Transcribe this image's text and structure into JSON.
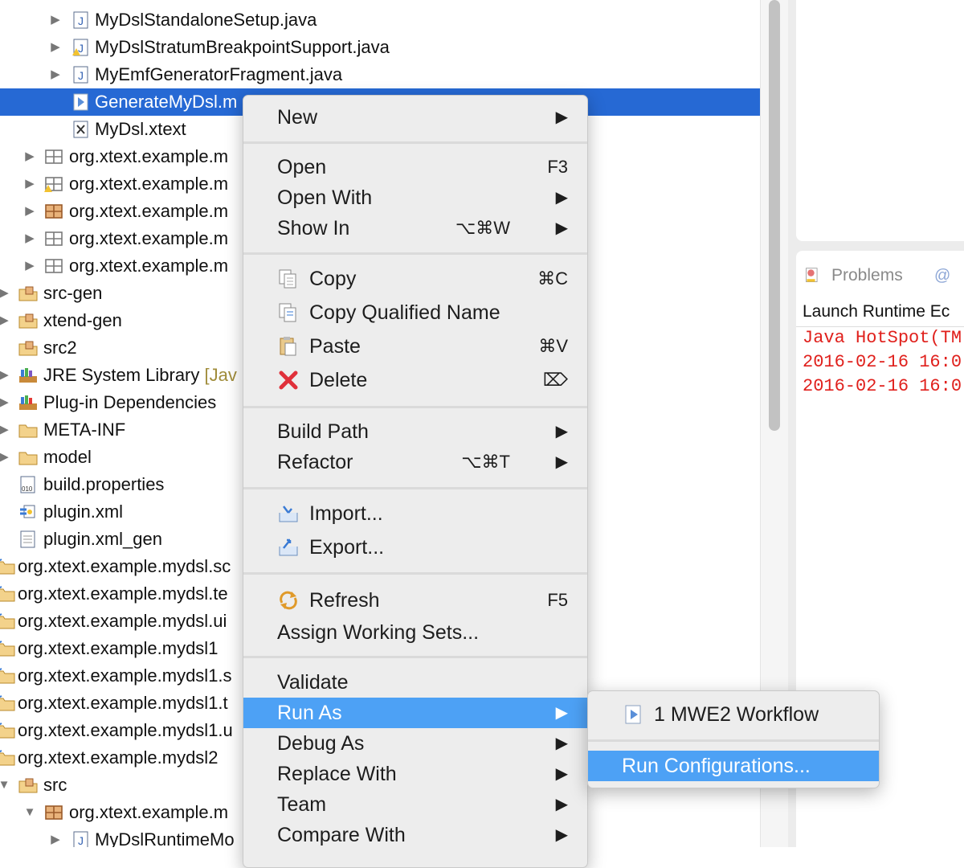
{
  "tree": {
    "rows": [
      {
        "label": "MyDslStandaloneSetup.java",
        "icon": "java-file-icon"
      },
      {
        "label": "MyDslStratumBreakpointSupport.java",
        "icon": "java-file-warning-icon"
      },
      {
        "label": "MyEmfGeneratorFragment.java",
        "icon": "java-file-icon"
      },
      {
        "label": "GenerateMyDsl.m",
        "icon": "mwe2-file-icon"
      },
      {
        "label": "MyDsl.xtext",
        "icon": "xtext-file-icon"
      },
      {
        "label": "org.xtext.example.m",
        "icon": "package-icon"
      },
      {
        "label": "org.xtext.example.m",
        "icon": "package-warning-icon"
      },
      {
        "label": "org.xtext.example.m",
        "icon": "package-icon"
      },
      {
        "label": "org.xtext.example.m",
        "icon": "package-icon"
      },
      {
        "label": "org.xtext.example.m",
        "icon": "package-icon"
      },
      {
        "label": "src-gen",
        "icon": "source-folder-icon"
      },
      {
        "label": "xtend-gen",
        "icon": "source-folder-icon"
      },
      {
        "label": "src2",
        "icon": "source-folder-icon"
      },
      {
        "label": "JRE System Library",
        "decoration": "[Jav",
        "icon": "library-icon"
      },
      {
        "label": "Plug-in Dependencies",
        "icon": "library-icon"
      },
      {
        "label": "META-INF",
        "icon": "folder-icon"
      },
      {
        "label": "model",
        "icon": "folder-icon"
      },
      {
        "label": "build.properties",
        "icon": "properties-file-icon"
      },
      {
        "label": "plugin.xml",
        "icon": "plugin-xml-icon"
      },
      {
        "label": "plugin.xml_gen",
        "icon": "text-file-icon"
      },
      {
        "label": "org.xtext.example.mydsl.sc",
        "icon": "project-icon"
      },
      {
        "label": "org.xtext.example.mydsl.te",
        "icon": "project-icon"
      },
      {
        "label": "org.xtext.example.mydsl.ui",
        "icon": "project-icon"
      },
      {
        "label": "org.xtext.example.mydsl1",
        "icon": "project-icon"
      },
      {
        "label": "org.xtext.example.mydsl1.s",
        "icon": "project-icon"
      },
      {
        "label": "org.xtext.example.mydsl1.t",
        "icon": "project-icon"
      },
      {
        "label": "org.xtext.example.mydsl1.u",
        "icon": "project-icon"
      },
      {
        "label": "org.xtext.example.mydsl2",
        "icon": "project-icon"
      },
      {
        "label": "src",
        "icon": "source-folder-icon"
      },
      {
        "label": "org.xtext.example.m",
        "icon": "package-icon"
      },
      {
        "label": "MyDslRuntimeMo",
        "icon": "java-file-icon"
      }
    ]
  },
  "context_menu": {
    "new": "New",
    "open": "Open",
    "open_shortcut": "F3",
    "open_with": "Open With",
    "show_in": "Show In",
    "show_in_shortcut": "⌥⌘W",
    "copy": "Copy",
    "copy_shortcut": "⌘C",
    "copy_qualified_name": "Copy Qualified Name",
    "paste": "Paste",
    "paste_shortcut": "⌘V",
    "delete": "Delete",
    "delete_shortcut": "⌦",
    "build_path": "Build Path",
    "refactor": "Refactor",
    "refactor_shortcut": "⌥⌘T",
    "import": "Import...",
    "export": "Export...",
    "refresh": "Refresh",
    "refresh_shortcut": "F5",
    "assign_working_sets": "Assign Working Sets...",
    "validate": "Validate",
    "run_as": "Run As",
    "debug_as": "Debug As",
    "replace_with": "Replace With",
    "team": "Team",
    "compare_with": "Compare With",
    "submenu_arrow": "▶"
  },
  "run_as_submenu": {
    "mwe2_workflow": "1 MWE2 Workflow",
    "run_configurations": "Run Configurations..."
  },
  "right_panel": {
    "problems_tab": "Problems",
    "second_tab": "@",
    "console_title": "Launch Runtime Ec",
    "console_lines": [
      "Java HotSpot(TM",
      "2016-02-16 16:0",
      "2016-02-16 16:0"
    ]
  },
  "colors": {
    "selection": "#2669d4",
    "menu_highlight": "#4da1f5",
    "console_error": "#e0201c"
  }
}
